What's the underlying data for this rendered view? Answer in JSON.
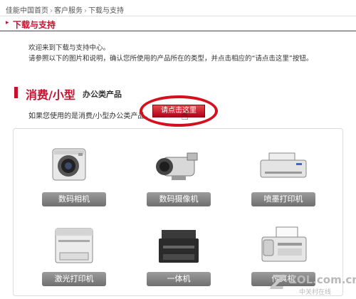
{
  "breadcrumb": {
    "items": [
      "佳能中国首页",
      "客户服务",
      "下载与支持"
    ],
    "separator": "›"
  },
  "section": {
    "arrow": "▸",
    "title": "下载与支持"
  },
  "intro": {
    "line1": "欢迎来到下载与支持中心。",
    "line2": "请参照以下的图片和说明，确认您所使用的产品所在的类型，并点击相应的“请点击这里”按钮。"
  },
  "category": {
    "title": "消费/小型",
    "subtitle": "办公类产品"
  },
  "hint": "如果您使用的是消费/小型办公类产品，",
  "click_button": "请点击这里",
  "products": [
    {
      "label": "数码相机",
      "icon": "camera-icon"
    },
    {
      "label": "数码摄像机",
      "icon": "camcorder-icon"
    },
    {
      "label": "喷墨打印机",
      "icon": "inkjet-printer-icon"
    },
    {
      "label": "激光打印机",
      "icon": "laser-printer-icon"
    },
    {
      "label": "一体机",
      "icon": "multifunction-icon"
    },
    {
      "label": "传真机",
      "icon": "fax-icon"
    }
  ],
  "watermark": {
    "letter": "Z",
    "site": "ZOL.com.cn",
    "cn": "中关村在线"
  },
  "colors": {
    "accent": "#c8102e",
    "button_gray": "#8a8a8a"
  }
}
